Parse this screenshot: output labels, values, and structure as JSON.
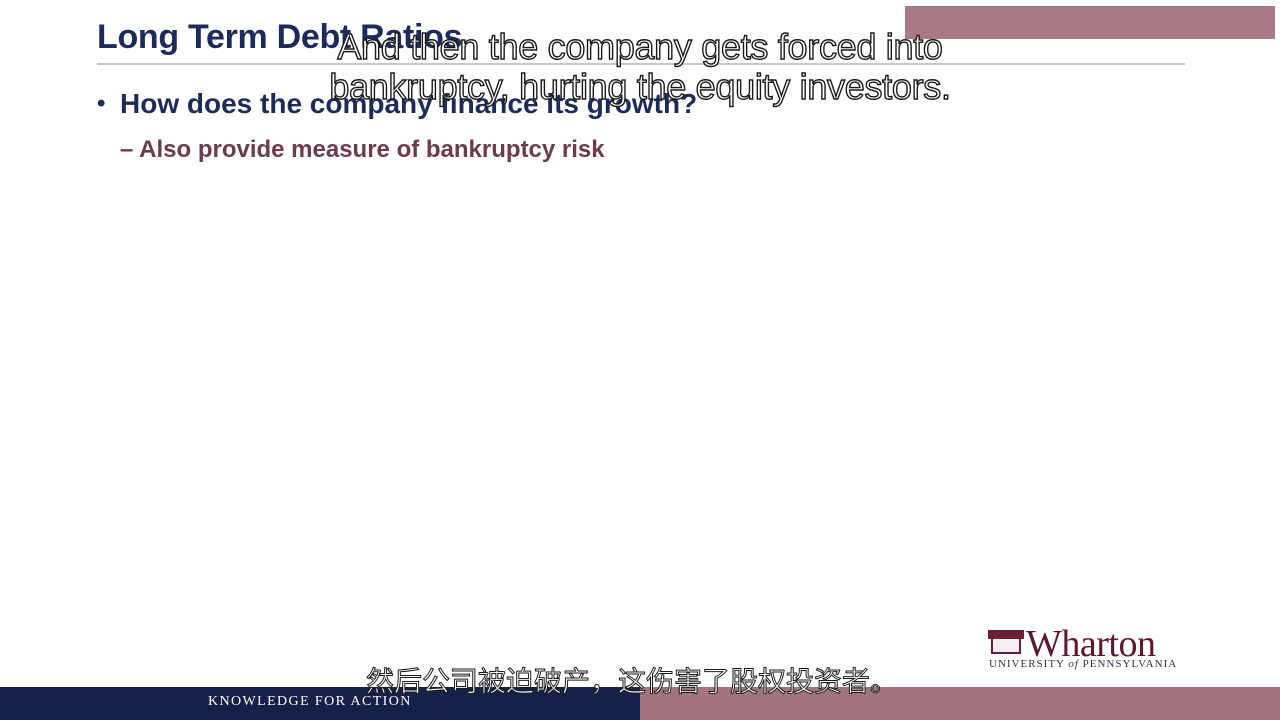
{
  "slide": {
    "title": "Long Term Debt Ratios",
    "bullet": "How does the company finance its growth?",
    "sub_bullet_dash": "–",
    "sub_bullet": "Also provide measure of bankruptcy risk"
  },
  "subtitles": {
    "english_line1": "And then the company gets forced into",
    "english_line2": "bankruptcy, hurting the equity investors.",
    "chinese": "然后公司被迫破产，这伤害了股权投资者。"
  },
  "logo": {
    "wordmark": "Wharton",
    "university_prefix": "UNIVERSITY ",
    "university_of": "of",
    "university_suffix": " PENNSYLVANIA"
  },
  "footer": {
    "tagline": "KNOWLEDGE FOR ACTION"
  },
  "colors": {
    "navy": "#1c2b5a",
    "maroon": "#6c3b4e",
    "footer_navy": "#16214a",
    "footer_rose": "#a3747f"
  }
}
